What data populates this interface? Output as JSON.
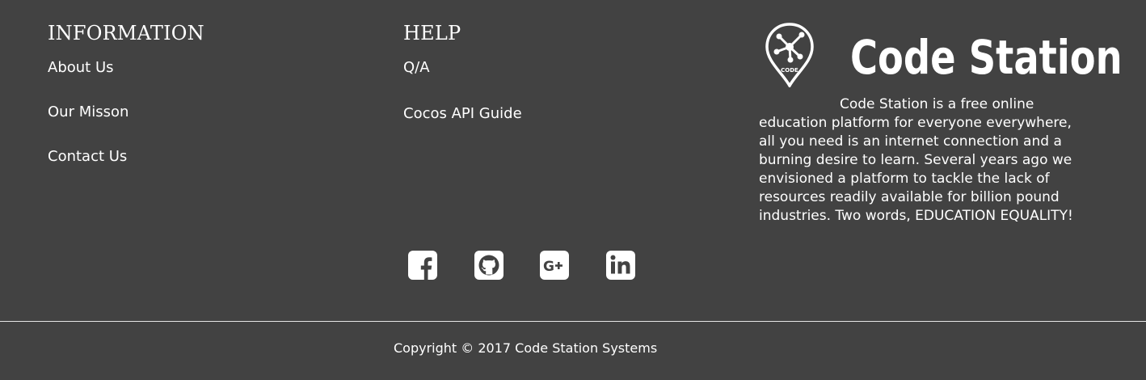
{
  "information": {
    "heading": "INFORMATION",
    "links": [
      "About Us",
      "Our Misson",
      "Contact Us"
    ]
  },
  "help": {
    "heading": "HELP",
    "links": [
      "Q/A",
      "Cocos API Guide"
    ]
  },
  "brand": {
    "name": "Code Station",
    "logo_text": "CODE",
    "description": "Code Station is a free online education platform for everyone everywhere, all you need is an internet connection and a burning desire to learn. Several years ago we envisioned a platform to tackle the lack of resources readily available for billion pound industries. Two words, EDUCATION EQUALITY!"
  },
  "social": {
    "icons": [
      "facebook-icon",
      "github-icon",
      "google-plus-icon",
      "linkedin-icon"
    ]
  },
  "copyright": "Copyright © 2017 Code Station Systems",
  "colors": {
    "background": "#424242",
    "text": "#ffffff",
    "divider": "#e6e6e6"
  }
}
